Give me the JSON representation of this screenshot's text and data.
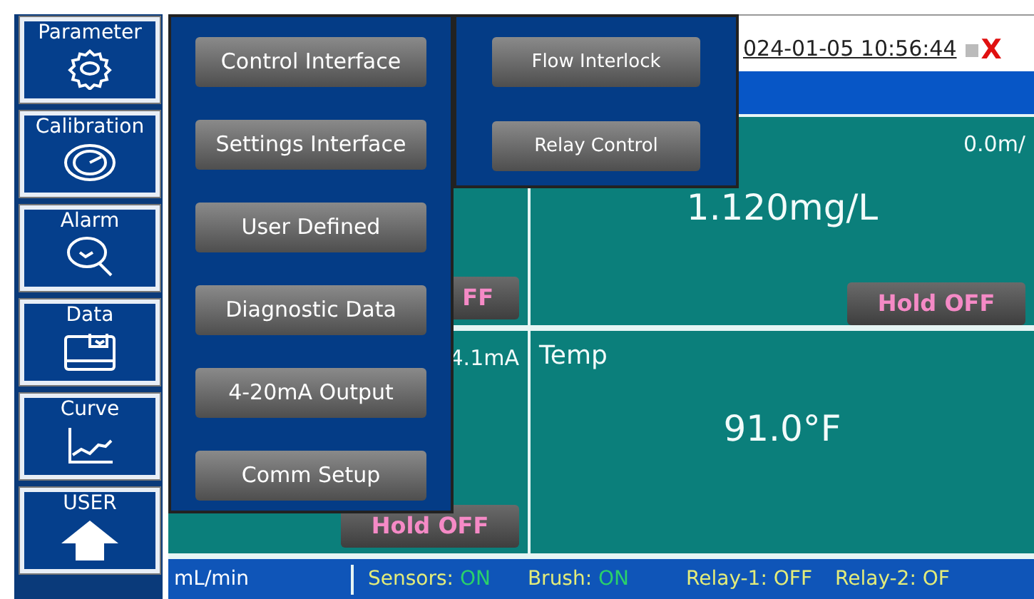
{
  "sidebar": {
    "items": [
      {
        "label": "Parameter",
        "kind": "gear"
      },
      {
        "label": "Calibration",
        "kind": "dial"
      },
      {
        "label": "Alarm",
        "kind": "magnifier"
      },
      {
        "label": "Data",
        "kind": "tray"
      },
      {
        "label": "Curve",
        "kind": "curve"
      },
      {
        "label": "USER",
        "kind": "house"
      }
    ]
  },
  "header": {
    "datetime": "024-01-05 10:56:44",
    "close": "X"
  },
  "panels": [
    {
      "hold_button": "FF"
    },
    {
      "corner_reading": "0.0m/",
      "value": "1.120mg/L",
      "hold_button": "Hold OFF"
    },
    {
      "corner_reading": "4.1mA",
      "hold_button": "Hold OFF"
    },
    {
      "title": "Temp",
      "value": "91.0°F"
    }
  ],
  "status_bar": {
    "flow": "mL/min",
    "items": [
      {
        "label": "Sensors:",
        "value": "ON",
        "on": true
      },
      {
        "label": "Brush:",
        "value": "ON",
        "on": true
      },
      {
        "label": "Relay-1:",
        "value": "OFF",
        "on": false
      },
      {
        "label": "Relay-2:",
        "value": "OF",
        "on": false
      }
    ]
  },
  "menu": {
    "items": [
      "Control Interface",
      "Settings Interface",
      "User Defined",
      "Diagnostic Data",
      "4-20mA Output",
      "Comm Setup"
    ]
  },
  "submenu": {
    "items": [
      "Flow Interlock",
      "Relay Control"
    ]
  }
}
